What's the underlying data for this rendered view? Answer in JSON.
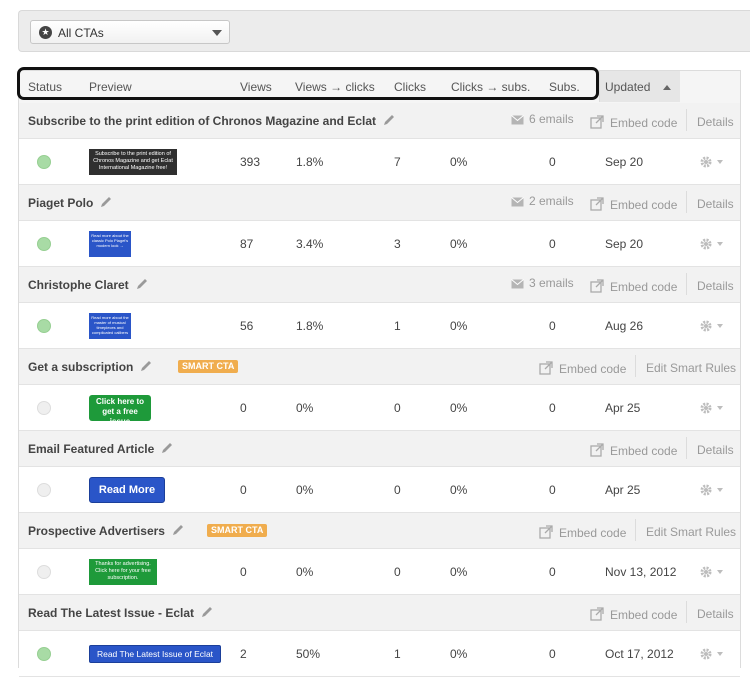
{
  "filter": {
    "selected": "All CTAs"
  },
  "columns": {
    "status": "Status",
    "preview": "Preview",
    "views": "Views",
    "views_clicks": "Views → clicks",
    "clicks": "Clicks",
    "clicks_subs": "Clicks → subs.",
    "subs": "Subs.",
    "updated": "Updated"
  },
  "labels": {
    "embed": "Embed code",
    "details": "Details",
    "edit_smart": "Edit Smart Rules",
    "smart_badge": "SMART CTA"
  },
  "ctas": [
    {
      "name": "Subscribe to the print edition of Chronos Magazine and Eclat",
      "emails": "6 emails",
      "smart": false,
      "active": true,
      "preview_text": "Subscribe to the print edition of Chronos Magazine and get Eclat International Magazine free!",
      "views": "393",
      "views_clicks": "1.8%",
      "clicks": "7",
      "clicks_subs": "0%",
      "subs": "0",
      "updated": "Sep 20"
    },
    {
      "name": "Piaget Polo",
      "emails": "2 emails",
      "smart": false,
      "active": true,
      "preview_text": "Read more about the classic Polo Piaget's modern look →",
      "views": "87",
      "views_clicks": "3.4%",
      "clicks": "3",
      "clicks_subs": "0%",
      "subs": "0",
      "updated": "Sep 20"
    },
    {
      "name": "Christophe Claret",
      "emails": "3 emails",
      "smart": false,
      "active": true,
      "preview_text": "Read more about the master of musical timepieces and complicated calibers",
      "views": "56",
      "views_clicks": "1.8%",
      "clicks": "1",
      "clicks_subs": "0%",
      "subs": "0",
      "updated": "Aug 26"
    },
    {
      "name": "Get a subscription",
      "emails": "",
      "smart": true,
      "active": false,
      "preview_text": "Click here to get a free issue",
      "views": "0",
      "views_clicks": "0%",
      "clicks": "0",
      "clicks_subs": "0%",
      "subs": "0",
      "updated": "Apr 25"
    },
    {
      "name": "Email Featured Article",
      "emails": "",
      "smart": false,
      "active": false,
      "preview_text": "Read More",
      "views": "0",
      "views_clicks": "0%",
      "clicks": "0",
      "clicks_subs": "0%",
      "subs": "0",
      "updated": "Apr 25"
    },
    {
      "name": "Prospective Advertisers",
      "emails": "",
      "smart": true,
      "active": false,
      "preview_text": "Thanks for advertising. Click here for your free subscription.",
      "views": "0",
      "views_clicks": "0%",
      "clicks": "0",
      "clicks_subs": "0%",
      "subs": "0",
      "updated": "Nov 13, 2012"
    },
    {
      "name": "Read The Latest Issue - Eclat",
      "emails": "",
      "smart": false,
      "active": true,
      "preview_text": "Read The Latest Issue of Eclat",
      "views": "2",
      "views_clicks": "50%",
      "clicks": "1",
      "clicks_subs": "0%",
      "subs": "0",
      "updated": "Oct 17, 2012"
    }
  ],
  "colors": {
    "active_dot": "#a8dba5",
    "smart_badge": "#f0ad4e",
    "thumb_dark": "#2f2f2f",
    "thumb_blue": "#2a55c8",
    "thumb_green": "#1e9a3a"
  }
}
